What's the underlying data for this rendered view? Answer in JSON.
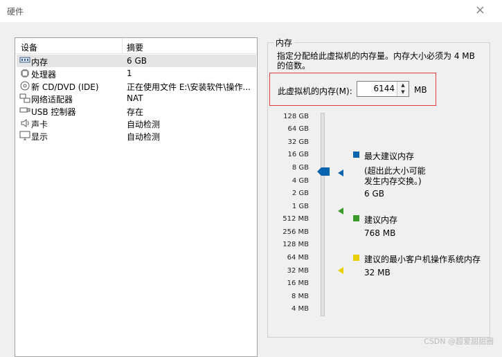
{
  "window": {
    "title": "硬件",
    "close_glyph": "×"
  },
  "devices": {
    "col_device": "设备",
    "col_summary": "摘要",
    "rows": [
      {
        "icon": "memory-icon",
        "name": "内存",
        "summary": "6 GB"
      },
      {
        "icon": "cpu-icon",
        "name": "处理器",
        "summary": "1"
      },
      {
        "icon": "cd-icon",
        "name": "新 CD/DVD (IDE)",
        "summary": "正在使用文件 E:\\安装软件\\操作..."
      },
      {
        "icon": "network-icon",
        "name": "网络适配器",
        "summary": "NAT"
      },
      {
        "icon": "usb-icon",
        "name": "USB 控制器",
        "summary": "存在"
      },
      {
        "icon": "speaker-icon",
        "name": "声卡",
        "summary": "自动检测"
      },
      {
        "icon": "monitor-icon",
        "name": "显示",
        "summary": "自动检测"
      }
    ]
  },
  "memory": {
    "group_label": "内存",
    "description": "指定分配给此虚拟机的内存量。内存大小必须为 4 MB 的倍数。",
    "field_label": "此虚拟机的内存(M):",
    "value": "6144",
    "unit": "MB",
    "scale_labels": [
      "128 GB",
      "64 GB",
      "32 GB",
      "16 GB",
      "8 GB",
      "4 GB",
      "2 GB",
      "1 GB",
      "512 MB",
      "256 MB",
      "128 MB",
      "64 MB",
      "32 MB",
      "16 MB",
      "8 MB",
      "4 MB"
    ],
    "legend": {
      "max": {
        "title": "最大建议内存",
        "note1": "(超出此大小可能",
        "note2": "发生内存交换。)",
        "value": "6 GB",
        "color": "#0a64ad"
      },
      "recommended": {
        "title": "建议内存",
        "value": "768 MB",
        "color": "#3a9a2a"
      },
      "min": {
        "title": "建议的最小客户机操作系统内存",
        "value": "32 MB",
        "color": "#e8d000"
      }
    }
  },
  "watermark": "CSDN @超爱甜甜圈"
}
